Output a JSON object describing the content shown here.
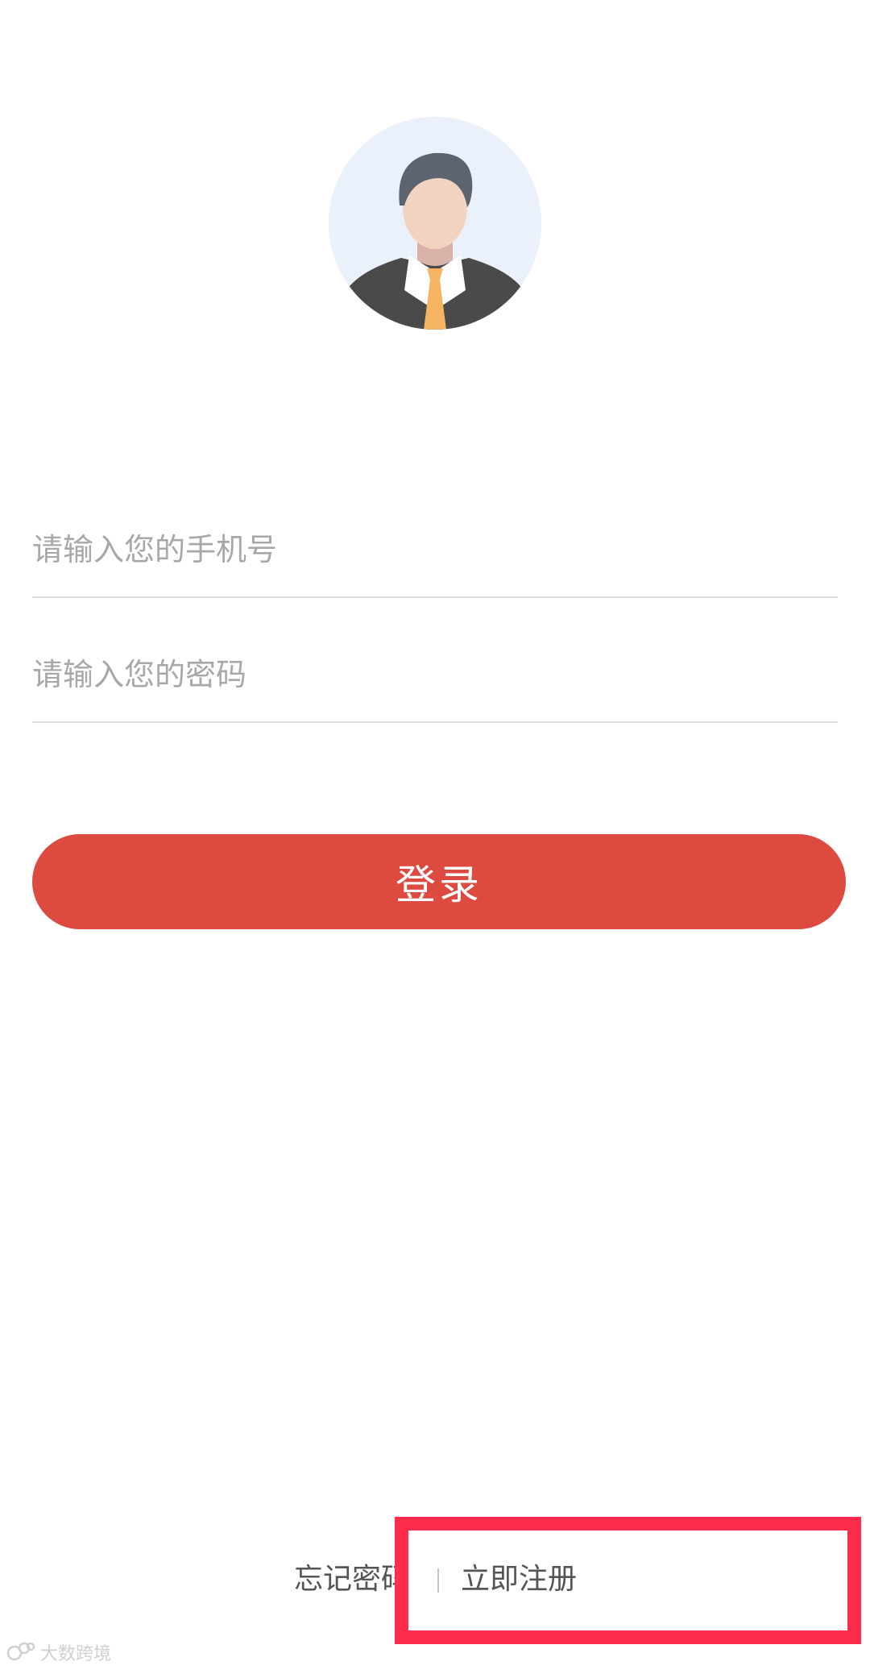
{
  "login_form": {
    "phone_placeholder": "请输入您的手机号",
    "password_placeholder": "请输入您的密码",
    "login_label": "登录"
  },
  "footer": {
    "forgot_password": "忘记密码",
    "register": "立即注册"
  },
  "watermark": {
    "text": "大数跨境"
  },
  "colors": {
    "primary": "#dd4b40",
    "highlight": "#ff2d4b",
    "avatar_background": "#eaf1fb"
  }
}
